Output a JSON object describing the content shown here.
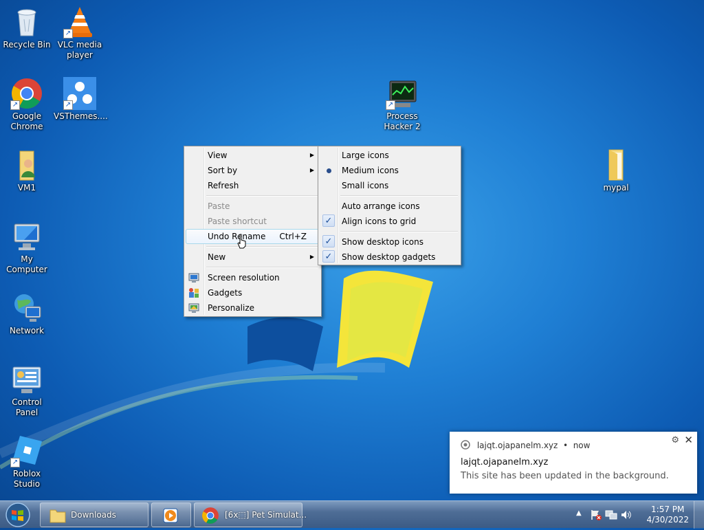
{
  "desktop_icons": [
    {
      "label": "Recycle Bin",
      "icon": "recycle-bin-icon"
    },
    {
      "label": "VLC media player",
      "icon": "vlc-icon"
    },
    {
      "label": "Google Chrome",
      "icon": "chrome-icon"
    },
    {
      "label": "VSThemes....",
      "icon": "vsthemes-icon"
    },
    {
      "label": "Process Hacker 2",
      "icon": "process-hacker-icon"
    },
    {
      "label": "VM1",
      "icon": "user-folder-icon"
    },
    {
      "label": "mypal",
      "icon": "folder-icon"
    },
    {
      "label": "My Computer",
      "icon": "computer-icon"
    },
    {
      "label": "Network",
      "icon": "network-icon"
    },
    {
      "label": "Control Panel",
      "icon": "control-panel-icon"
    },
    {
      "label": "Roblox Studio",
      "icon": "roblox-studio-icon"
    }
  ],
  "context_menu": {
    "view": "View",
    "sort_by": "Sort by",
    "refresh": "Refresh",
    "paste": "Paste",
    "paste_shortcut": "Paste shortcut",
    "undo_rename": "Undo Rename",
    "undo_shortcut": "Ctrl+Z",
    "new": "New",
    "screen_resolution": "Screen resolution",
    "gadgets": "Gadgets",
    "personalize": "Personalize"
  },
  "view_submenu": {
    "large_icons": "Large icons",
    "medium_icons": "Medium icons",
    "small_icons": "Small icons",
    "auto_arrange": "Auto arrange icons",
    "align_to_grid": "Align icons to grid",
    "show_desktop_icons": "Show desktop icons",
    "show_desktop_gadgets": "Show desktop gadgets",
    "selected_size": "Medium icons",
    "checked": [
      "Align icons to grid",
      "Show desktop icons",
      "Show desktop gadgets"
    ]
  },
  "notification": {
    "source": "lajqt.ojapanelm.xyz",
    "time": "now",
    "title": "lajqt.ojapanelm.xyz",
    "message": "This site has been updated in the background."
  },
  "taskbar": {
    "buttons": [
      {
        "label": "Downloads",
        "icon": "folder-icon"
      },
      {
        "label": "",
        "icon": "media-player-icon"
      },
      {
        "label": "[6x⬚] Pet Simulat...",
        "icon": "chrome-icon"
      }
    ],
    "time": "1:57 PM",
    "date": "4/30/2022"
  },
  "colors": {
    "desktop_blue": "#1f7fd4",
    "menu_bg": "#f0f0f0",
    "highlight_border": "#a8d8eb"
  }
}
